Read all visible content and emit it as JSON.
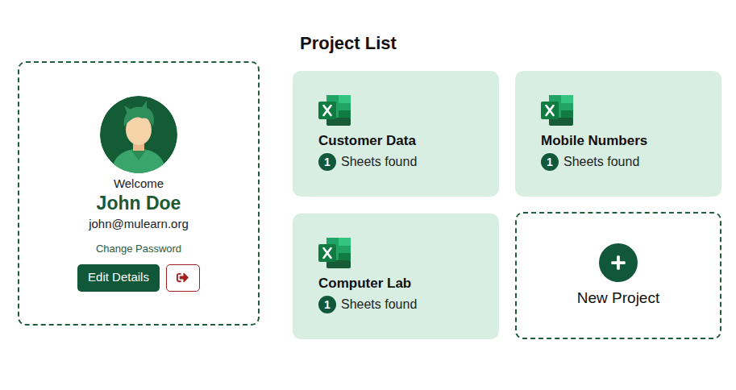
{
  "title": "Project List",
  "profile": {
    "welcome": "Welcome",
    "name": "John Doe",
    "email": "john@mulearn.org",
    "change_password": "Change Password",
    "edit_button": "Edit Details"
  },
  "projects": [
    {
      "name": "Customer Data",
      "count": "1",
      "label": "Sheets found"
    },
    {
      "name": "Mobile Numbers",
      "count": "1",
      "label": "Sheets found"
    },
    {
      "name": "Computer Lab",
      "count": "1",
      "label": "Sheets found"
    }
  ],
  "new_project": {
    "label": "New Project"
  }
}
